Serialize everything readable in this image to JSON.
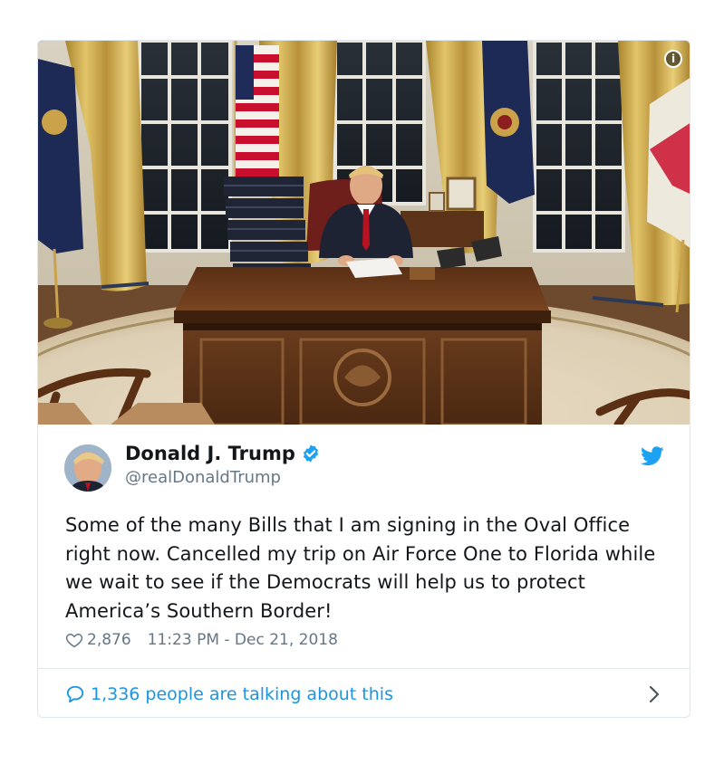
{
  "tweet": {
    "author_name": "Donald J. Trump",
    "author_handle": "@realDonaldTrump",
    "text": "Some of the many Bills that I am signing in the Oval Office right now. Cancelled my trip on Air Force One to Florida while we wait to see if the Democrats will help us to protect America’s Southern Border!",
    "likes": "2,876",
    "timestamp": "11:23 PM - Dec 21, 2018",
    "talking_about": "1,336 people are talking about this",
    "info_glyph": "i"
  },
  "icons": {
    "verified": "verified-badge-icon",
    "brand": "twitter-bird-icon",
    "like": "heart-icon",
    "reply": "speech-bubble-icon",
    "more": "chevron-right-icon",
    "info": "info-icon"
  },
  "colors": {
    "brand_blue": "#1da1f2",
    "link_blue": "#1b95e0",
    "secondary_text": "#657786",
    "border": "#e1e8ed"
  }
}
